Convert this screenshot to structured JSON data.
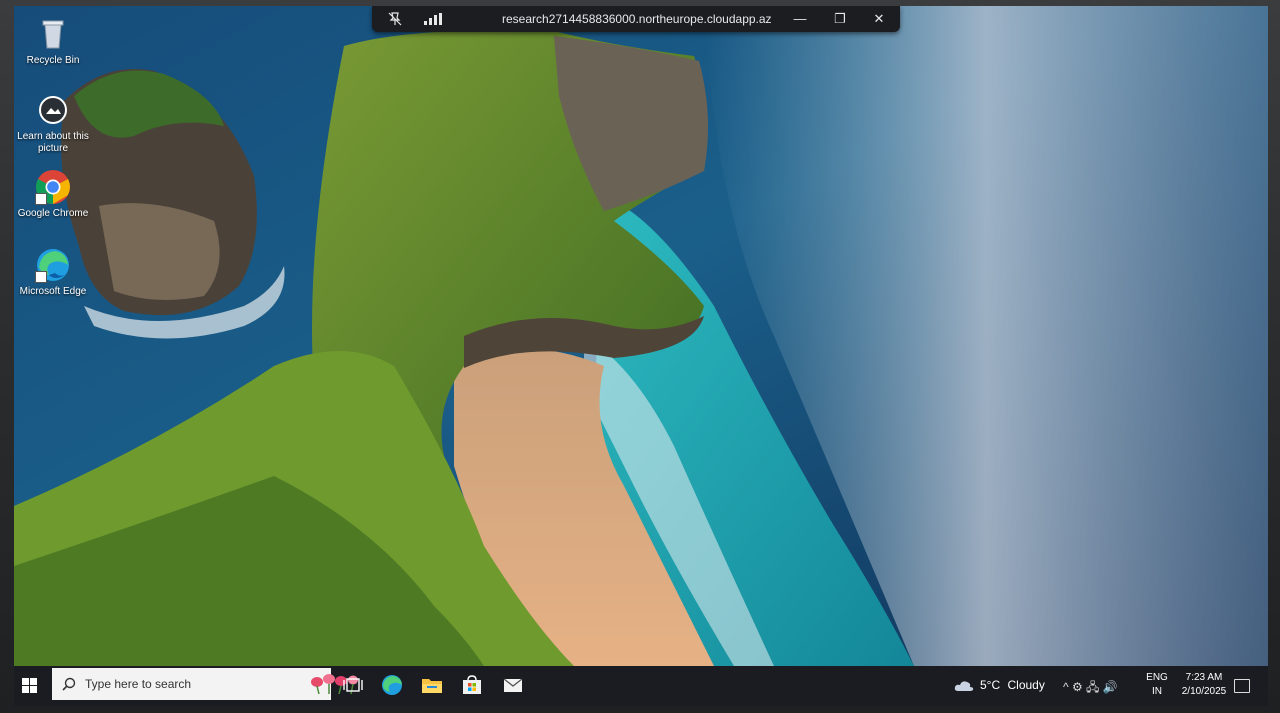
{
  "remote_bar": {
    "title": "research2714458836000.northeurope.cloudapp.az...",
    "minimize": "—",
    "restore": "❐",
    "close": "✕"
  },
  "desktop_icons": [
    {
      "label": "Recycle Bin"
    },
    {
      "label": "Learn about this picture"
    },
    {
      "label": "Google Chrome"
    },
    {
      "label": "Microsoft Edge"
    }
  ],
  "taskbar": {
    "search_placeholder": "Type here to search",
    "apps": [
      "task-view",
      "edge",
      "file-explorer",
      "microsoft-store",
      "mail"
    ],
    "weather": {
      "temp": "5°C",
      "condition": "Cloudy"
    },
    "tray_symbols": "^ ⚙ 🖧 🔊",
    "language": {
      "line1": "ENG",
      "line2": "IN"
    },
    "clock": {
      "time": "7:23 AM",
      "date": "2/10/2025"
    }
  },
  "colors": {
    "taskbar_bg": "#1a1c22",
    "rdp_bar_bg": "#1b1d20",
    "sea_deep": "#134a73",
    "sea_turquoise": "#1fa6b0",
    "cliff_green": "#5f8a2a",
    "sand": "#d9a170"
  }
}
